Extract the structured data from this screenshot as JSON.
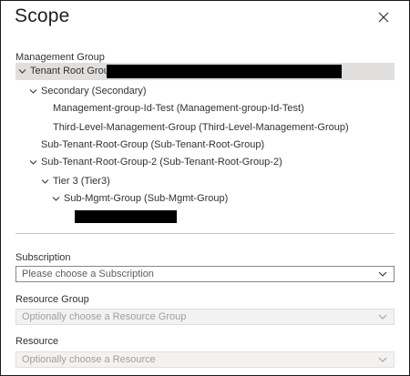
{
  "dialog": {
    "title": "Scope",
    "close_icon": "close-icon"
  },
  "management_group": {
    "label": "Management Group",
    "tree": [
      {
        "label": "Tenant Root Group",
        "expanded": true,
        "selected": true
      },
      {
        "label": "Secondary (Secondary)",
        "expanded": true
      },
      {
        "label": "Management-group-Id-Test (Management-group-Id-Test)"
      },
      {
        "label": "Third-Level-Management-Group (Third-Level-Management-Group)"
      },
      {
        "label": "Sub-Tenant-Root-Group (Sub-Tenant-Root-Group)"
      },
      {
        "label": "Sub-Tenant-Root-Group-2 (Sub-Tenant-Root-Group-2)",
        "expanded": true
      },
      {
        "label": "Tier 3 (Tier3)",
        "expanded": true
      },
      {
        "label": "Sub-Mgmt-Group (Sub-Mgmt-Group)",
        "expanded": true
      }
    ]
  },
  "subscription": {
    "label": "Subscription",
    "placeholder": "Please choose a Subscription"
  },
  "resource_group": {
    "label": "Resource Group",
    "placeholder": "Optionally choose a Resource Group"
  },
  "resource": {
    "label": "Resource",
    "placeholder": "Optionally choose a Resource"
  },
  "colors": {
    "selected_row": "#e1dfdd",
    "border": "#8a8886",
    "disabled_border": "#e1dfdd",
    "text": "#323130",
    "disabled_text": "#a19f9d"
  }
}
